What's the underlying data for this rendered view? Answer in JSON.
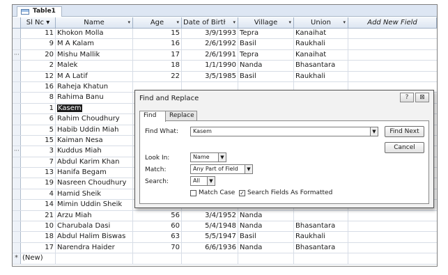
{
  "table_tab": {
    "label": "Table1"
  },
  "columns": {
    "sl_no": "Sl Nc",
    "name": "Name",
    "age": "Age",
    "dob": "Date of Birtł",
    "village": "Village",
    "union": "Union",
    "add_field": "Add New Field"
  },
  "rows": [
    {
      "sl": "11",
      "name": "Khokon Molla",
      "age": "15",
      "dob": "3/9/1993",
      "village": "Tepra",
      "union": "Kanaihat"
    },
    {
      "sl": "9",
      "name": "M A Kalam",
      "age": "16",
      "dob": "2/6/1992",
      "village": "Basil",
      "union": "Raukhali"
    },
    {
      "sl": "20",
      "name": "Mishu Mallik",
      "age": "17",
      "dob": "2/6/1991",
      "village": "Tepra",
      "union": "Kanaihat"
    },
    {
      "sl": "2",
      "name": "Malek",
      "age": "18",
      "dob": "1/1/1990",
      "village": "Nanda",
      "union": "Bhasantara"
    },
    {
      "sl": "12",
      "name": "M A Latif",
      "age": "22",
      "dob": "3/5/1985",
      "village": "Basil",
      "union": "Raukhali"
    },
    {
      "sl": "16",
      "name": "Raheja Khatun",
      "age": "",
      "dob": "",
      "village": "",
      "union": ""
    },
    {
      "sl": "8",
      "name": "Rahima Banu",
      "age": "",
      "dob": "",
      "village": "",
      "union": ""
    },
    {
      "sl": "1",
      "name": "Kasem",
      "age": "",
      "dob": "",
      "village": "",
      "union": ""
    },
    {
      "sl": "6",
      "name": "Rahim Choudhury",
      "age": "",
      "dob": "",
      "village": "",
      "union": ""
    },
    {
      "sl": "5",
      "name": "Habib Uddin Miah",
      "age": "",
      "dob": "",
      "village": "",
      "union": ""
    },
    {
      "sl": "15",
      "name": "Kaiman Nesa",
      "age": "",
      "dob": "",
      "village": "",
      "union": ""
    },
    {
      "sl": "3",
      "name": "Kuddus Miah",
      "age": "",
      "dob": "",
      "village": "",
      "union": ""
    },
    {
      "sl": "7",
      "name": "Abdul Karim Khan",
      "age": "",
      "dob": "",
      "village": "",
      "union": ""
    },
    {
      "sl": "13",
      "name": "Hanifa Begam",
      "age": "",
      "dob": "",
      "village": "",
      "union": ""
    },
    {
      "sl": "19",
      "name": "Nasreen Choudhury",
      "age": "",
      "dob": "",
      "village": "",
      "union": ""
    },
    {
      "sl": "4",
      "name": "Hamid Sheik",
      "age": "",
      "dob": "",
      "village": "",
      "union": ""
    },
    {
      "sl": "14",
      "name": "Mimin Uddin Sheik",
      "age": "",
      "dob": "",
      "village": "",
      "union": ""
    },
    {
      "sl": "21",
      "name": "Arzu Miah",
      "age": "56",
      "dob": "3/4/1952",
      "village": "Nanda",
      "union": ""
    },
    {
      "sl": "10",
      "name": "Charubala Dasi",
      "age": "60",
      "dob": "5/4/1948",
      "village": "Nanda",
      "union": "Bhasantara"
    },
    {
      "sl": "18",
      "name": "Abdul Halim Biswas",
      "age": "63",
      "dob": "5/5/1947",
      "village": "Basil",
      "union": "Raukhali"
    },
    {
      "sl": "17",
      "name": "Narendra Haider",
      "age": "70",
      "dob": "6/6/1936",
      "village": "Nanda",
      "union": "Bhasantara"
    }
  ],
  "new_row": {
    "marker": "*",
    "label": "(New)"
  },
  "dialog": {
    "title": "Find and Replace",
    "help_glyph": "?",
    "close_glyph": "⊠",
    "tabs": {
      "find": "Find",
      "replace": "Replace"
    },
    "find_what_label": "Find What:",
    "find_what_value": "Kasem",
    "find_next": "Find Next",
    "cancel": "Cancel",
    "look_in_label": "Look In:",
    "look_in_value": "Name",
    "match_label": "Match:",
    "match_value": "Any Part of Field",
    "search_label": "Search:",
    "search_value": "All",
    "match_case": "Match Case",
    "search_formatted": "Search Fields As Formatted",
    "search_formatted_checked": true,
    "match_case_checked": false
  }
}
